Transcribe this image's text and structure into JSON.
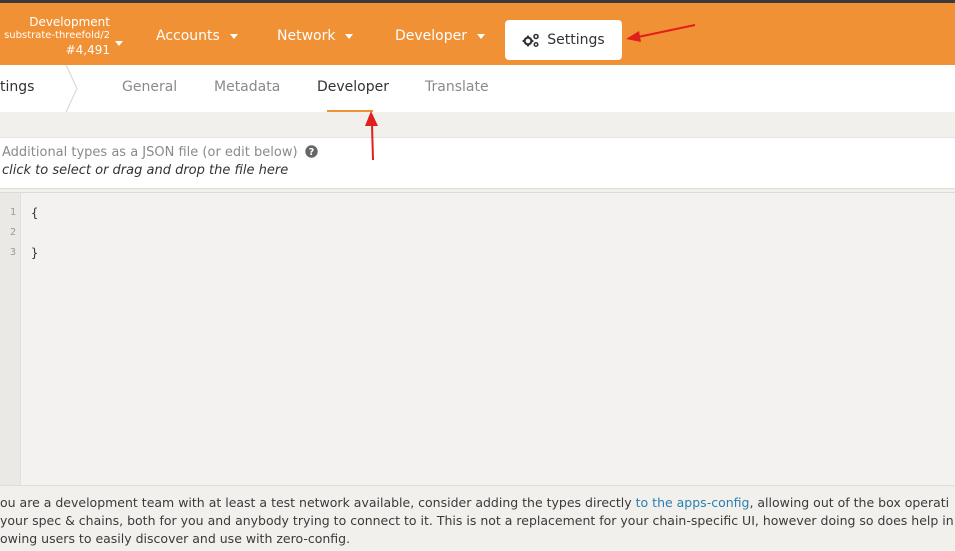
{
  "chain": {
    "name": "Development",
    "spec": "substrate-threefold/2",
    "block": "#4,491"
  },
  "topnav": {
    "accounts": "Accounts",
    "network": "Network",
    "developer": "Developer",
    "settings": "Settings"
  },
  "colors": {
    "topbar": "#f19135",
    "link": "#2a7fb0",
    "annotation": "#e0201b"
  },
  "subnav": {
    "crumb": "tings",
    "tabs": [
      "General",
      "Metadata",
      "Developer",
      "Translate"
    ],
    "active_tab": "Developer"
  },
  "upload": {
    "label": "Additional types as a JSON file (or edit below)",
    "hint": "click to select or drag and drop the file here"
  },
  "editor": {
    "lines": [
      {
        "num": "1",
        "text": "{"
      },
      {
        "num": "2",
        "text": ""
      },
      {
        "num": "3",
        "text": "}"
      }
    ]
  },
  "footer": {
    "line1_before": "ou are a development team with at least a test network available, consider adding the types directly ",
    "link": "to the apps-config",
    "line1_after": ", allowing out of the box operati",
    "line2": " your spec & chains, both for you and anybody trying to connect to it. This is not a replacement for your chain-specific UI, however doing so does help in",
    "line3": "owing users to easily discover and use with zero-config."
  }
}
